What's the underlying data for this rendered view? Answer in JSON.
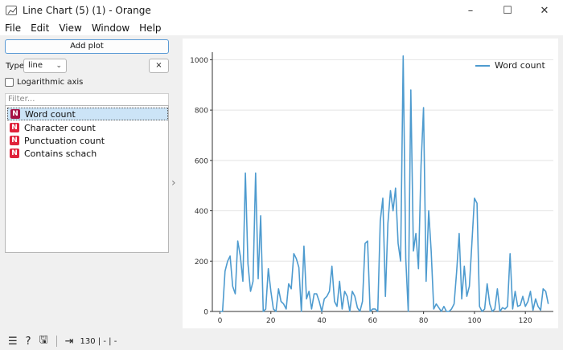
{
  "window": {
    "title": "Line Chart (5) (1) - Orange",
    "minimize": "–",
    "maximize": "☐",
    "close": "✕"
  },
  "menu": [
    "File",
    "Edit",
    "View",
    "Window",
    "Help"
  ],
  "controls": {
    "add_plot": "Add plot",
    "type_label": "Type:",
    "type_value": "line",
    "clear": "×",
    "log_axis": "Logarithmic axis",
    "filter_placeholder": "Filter...",
    "badge": "N"
  },
  "variables": [
    {
      "label": "Word count",
      "selected": true
    },
    {
      "label": "Character count",
      "selected": false
    },
    {
      "label": "Punctuation count",
      "selected": false
    },
    {
      "label": "Contains schach",
      "selected": false
    }
  ],
  "statusbar": {
    "info": "130 | - | -"
  },
  "colors": {
    "series": "#4e9bcf",
    "selection": "#cce4f7",
    "badge": "#e0223a"
  },
  "chart_data": {
    "type": "line",
    "series": [
      {
        "name": "Word count",
        "x": [
          0,
          1,
          2,
          3,
          4,
          5,
          6,
          7,
          8,
          9,
          10,
          11,
          12,
          13,
          14,
          15,
          16,
          17,
          18,
          19,
          20,
          21,
          22,
          23,
          24,
          25,
          26,
          27,
          28,
          29,
          30,
          31,
          32,
          33,
          34,
          35,
          36,
          37,
          38,
          39,
          40,
          41,
          42,
          43,
          44,
          45,
          46,
          47,
          48,
          49,
          50,
          51,
          52,
          53,
          54,
          55,
          56,
          57,
          58,
          59,
          60,
          61,
          62,
          63,
          64,
          65,
          66,
          67,
          68,
          69,
          70,
          71,
          72,
          73,
          74,
          75,
          76,
          77,
          78,
          79,
          80,
          81,
          82,
          83,
          84,
          85,
          86,
          87,
          88,
          89,
          90,
          91,
          92,
          93,
          94,
          95,
          96,
          97,
          98,
          99,
          100,
          101,
          102,
          103,
          104,
          105,
          106,
          107,
          108,
          109,
          110,
          111,
          112,
          113,
          114,
          115,
          116,
          117,
          118,
          119,
          120,
          121,
          122,
          123,
          124,
          125,
          126,
          127,
          128,
          129
        ],
        "values": [
          0,
          0,
          160,
          200,
          220,
          100,
          70,
          280,
          220,
          120,
          550,
          190,
          80,
          120,
          550,
          130,
          380,
          0,
          10,
          170,
          80,
          10,
          0,
          90,
          40,
          30,
          10,
          110,
          90,
          230,
          210,
          175,
          0,
          260,
          50,
          80,
          10,
          70,
          70,
          40,
          0,
          50,
          60,
          80,
          180,
          40,
          20,
          120,
          10,
          80,
          60,
          0,
          80,
          60,
          15,
          0,
          40,
          270,
          280,
          0,
          10,
          10,
          0,
          360,
          450,
          60,
          350,
          480,
          400,
          490,
          270,
          200,
          1015,
          210,
          0,
          880,
          240,
          310,
          170,
          580,
          810,
          120,
          400,
          240,
          10,
          30,
          15,
          0,
          20,
          0,
          0,
          10,
          30,
          160,
          310,
          50,
          180,
          60,
          100,
          270,
          450,
          430,
          20,
          0,
          10,
          110,
          30,
          0,
          10,
          90,
          0,
          15,
          10,
          20,
          230,
          10,
          80,
          20,
          25,
          60,
          20,
          40,
          80,
          5,
          50,
          20,
          5,
          90,
          80,
          30
        ]
      }
    ],
    "xticks": [
      0,
      20,
      40,
      60,
      80,
      100,
      120
    ],
    "yticks": [
      0,
      200,
      400,
      600,
      800,
      1000
    ],
    "xlim": [
      -3,
      131
    ],
    "ylim": [
      0,
      1030
    ],
    "grid": "horizontal",
    "legend": "top-right"
  }
}
